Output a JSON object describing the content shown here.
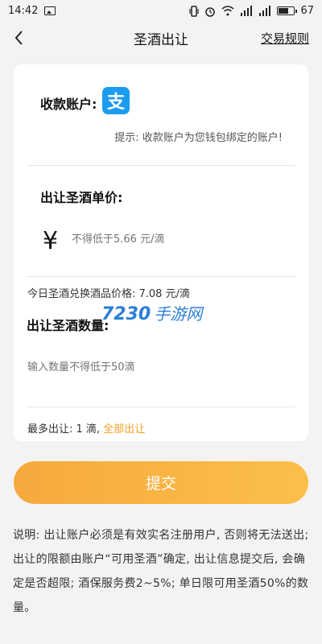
{
  "status": {
    "time": "14:42",
    "battery": "67"
  },
  "nav": {
    "title": "圣酒出让",
    "rules_label": "交易规则"
  },
  "account": {
    "label": "收款账户:",
    "hint": "提示: 收款账户为您钱包绑定的账户!"
  },
  "price": {
    "label": "出让圣酒单价:",
    "currency": "¥",
    "placeholder": "不得低于5.66 元/滴"
  },
  "today_price": "今日圣酒兑换酒品价格: 7.08 元/滴",
  "quantity": {
    "label": "出让圣酒数量:",
    "placeholder": "输入数量不得低于50滴"
  },
  "max": {
    "text": "最多出让: 1 滴,",
    "all_label": "全部出让"
  },
  "watermark": {
    "number": "7230",
    "text": "手游网"
  },
  "submit_label": "提交",
  "note": "说明: 出让账户必须是有效实名注册用户, 否则将无法送出; 出让的限额由账户“可用圣酒”确定, 出让信息提交后, 会确定是否超限; 酒保服务费2~5%; 单日限可用圣酒50%的数量。",
  "colors": {
    "accent": "#f5a023",
    "alipay": "#1b9cf0",
    "background": "#f3f3f3"
  }
}
